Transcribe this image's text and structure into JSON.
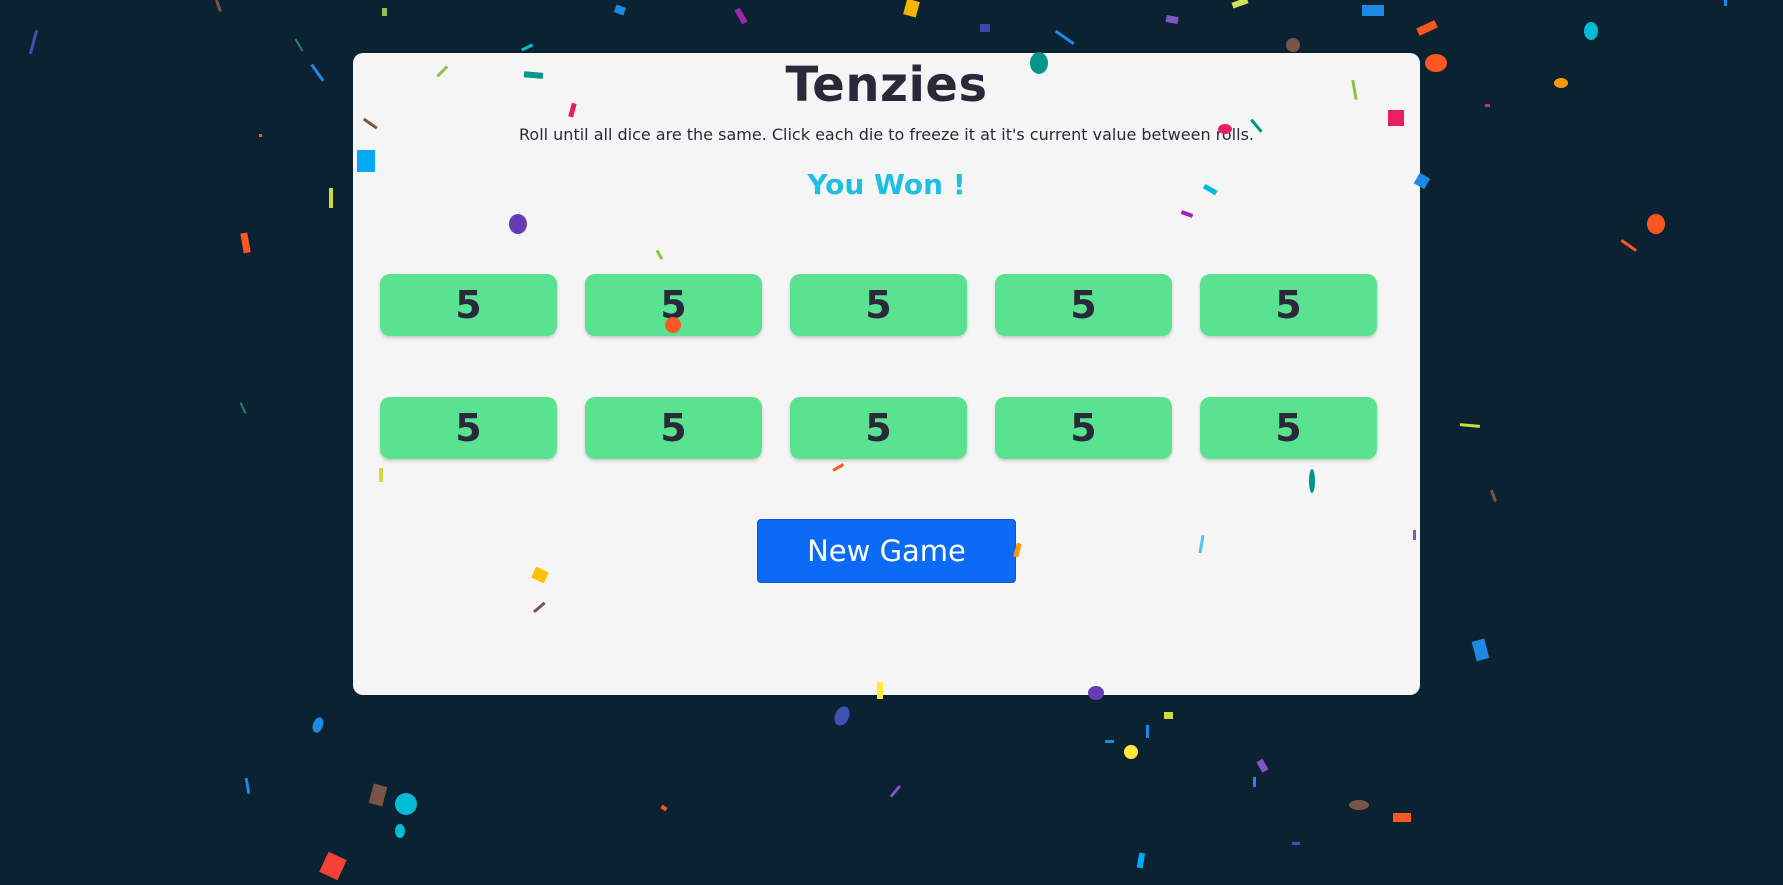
{
  "game": {
    "title": "Tenzies",
    "instructions": "Roll until all dice are the same. Click each die to freeze it at it's current value between rolls.",
    "status": "You Won !",
    "new_game_label": "New Game",
    "dice": [
      "5",
      "5",
      "5",
      "5",
      "5",
      "5",
      "5",
      "5",
      "5",
      "5"
    ]
  },
  "colors": {
    "background": "#0b2232",
    "card": "#f5f5f5",
    "die_held": "#59e391",
    "status_text": "#1fbfe0",
    "button": "#0b6bf7"
  }
}
